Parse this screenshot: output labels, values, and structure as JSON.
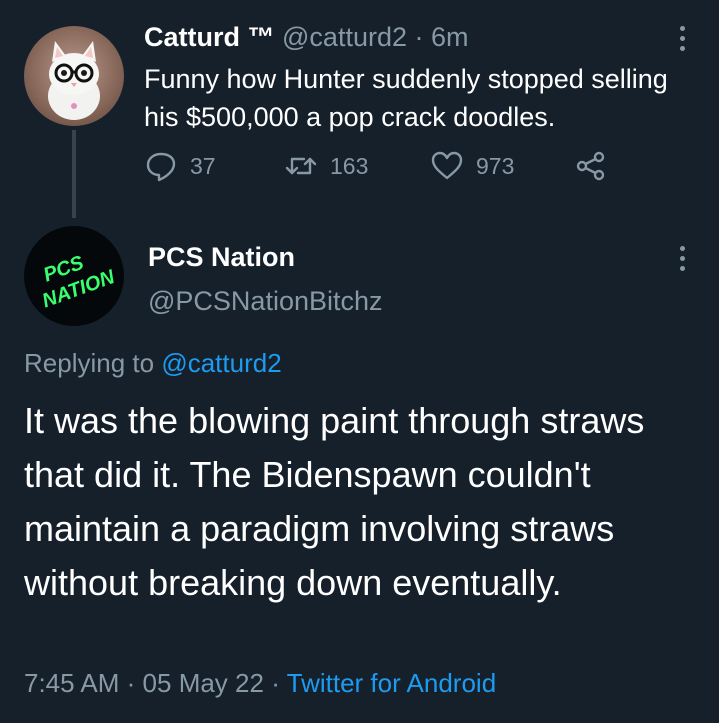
{
  "parent_tweet": {
    "display_name": "Catturd ™",
    "handle": "@catturd2",
    "separator": "·",
    "time_ago": "6m",
    "text": "Funny how Hunter suddenly stopped selling his $500,000 a pop crack doodles.",
    "avatar_icon": "cat-with-glasses-avatar",
    "actions": {
      "reply_count": "37",
      "retweet_count": "163",
      "like_count": "973"
    }
  },
  "reply_tweet": {
    "display_name": "PCS Nation",
    "handle": "@PCSNationBitchz",
    "avatar_text_line1": "PCS",
    "avatar_text_line2": "NATION",
    "avatar_color": "#39ff6e",
    "replying_prefix": "Replying to",
    "replying_to": "@catturd2",
    "text": "It was the blowing paint through straws that did it. The Bidenspawn couldn't maintain a paradigm involving straws without breaking down eventually.",
    "time": "7:45 AM",
    "separator1": "·",
    "date": "05 May 22",
    "separator2": "·",
    "source": "Twitter for Android"
  },
  "colors": {
    "background": "#15202b",
    "muted": "#8899a6",
    "link": "#1d9bf0"
  }
}
